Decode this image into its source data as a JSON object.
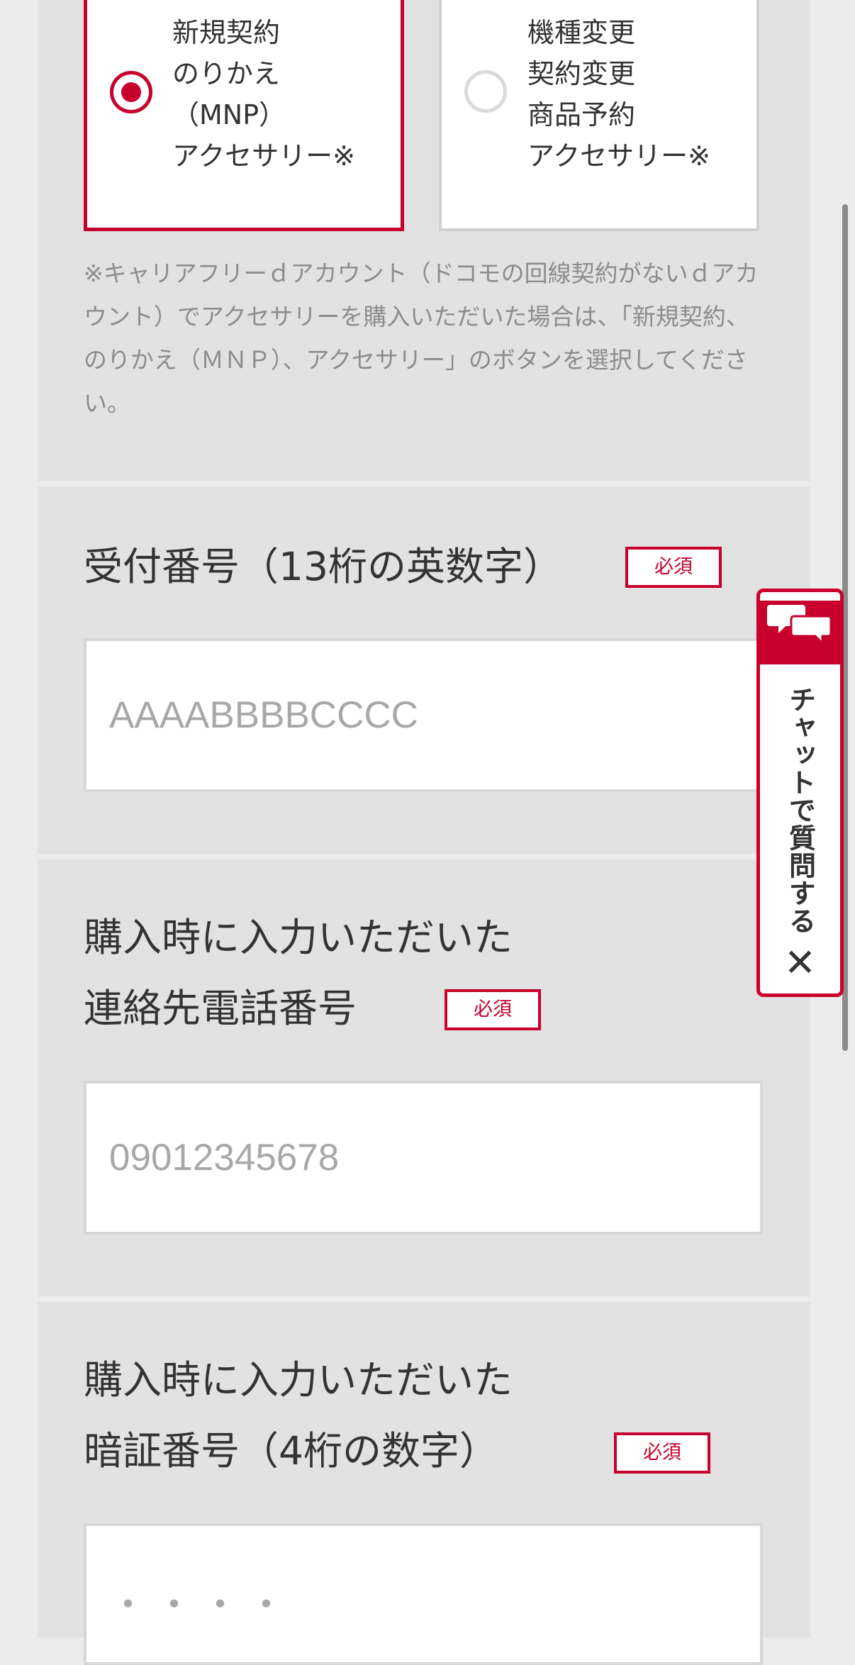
{
  "contract_type": {
    "options": [
      {
        "selected": true,
        "lines": [
          "新規契約",
          "のりかえ",
          "（MNP）",
          "アクセサリー※"
        ]
      },
      {
        "selected": false,
        "lines": [
          "機種変更",
          "契約変更",
          "商品予約",
          "アクセサリー※"
        ]
      }
    ],
    "note": "※キャリアフリーｄアカウント（ドコモの回線契約がないｄアカウント）でアクセサリーを購入いただいた場合は、「新規契約、のりかえ（ＭＮＰ）、アクセサリー」のボタンを選択してください。"
  },
  "receipt_number": {
    "label": "受付番号（13桁の英数字）",
    "required_badge": "必須",
    "placeholder": "AAAABBBBCCCC",
    "value": ""
  },
  "contact_phone": {
    "label_lines": [
      "購入時に入力いただいた",
      "連絡先電話番号"
    ],
    "required_badge": "必須",
    "placeholder": "09012345678",
    "value": ""
  },
  "pin": {
    "label_lines": [
      "購入時に入力いただいた",
      "暗証番号（4桁の数字）"
    ],
    "required_badge": "必須",
    "placeholder": "・・・・",
    "value": ""
  },
  "chat_widget": {
    "label": "チャットで質問する",
    "close_glyph": "✕",
    "icon": "chat-bubbles-icon"
  },
  "colors": {
    "accent": "#c8002d",
    "panel_background": "#e2e2e2",
    "page_background": "#ececec",
    "note_text": "#8c8c8c",
    "placeholder_text": "#a8a8a8"
  }
}
